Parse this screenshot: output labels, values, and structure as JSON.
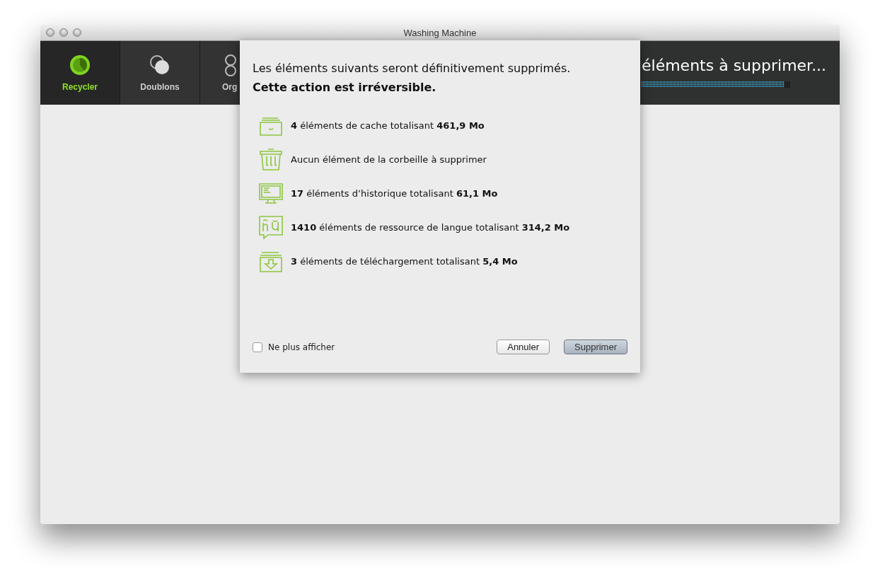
{
  "window": {
    "title": "Washing Machine"
  },
  "tabs": [
    {
      "label": "Recycler",
      "selected": true,
      "kind": "recycle"
    },
    {
      "label": "Doublons",
      "selected": false,
      "kind": "duplicates"
    },
    {
      "label": "Org",
      "selected": false,
      "kind": "organize"
    }
  ],
  "status": {
    "text": "éléments à supprimer...",
    "level": 0.96
  },
  "dialog": {
    "message": "Les éléments suivants seront définitivement supprimés.",
    "warning": "Cette action est irréversible.",
    "items": [
      {
        "kind": "cache",
        "text": "**4** éléments de cache totalisant **461,9 Mo**"
      },
      {
        "kind": "trash",
        "text": "Aucun élément de la corbeille à supprimer"
      },
      {
        "kind": "history",
        "text": "**17** éléments d’historique totalisant **61,1 Mo**"
      },
      {
        "kind": "language",
        "text": "**1410** éléments de ressource de langue totalisant **314,2 Mo**"
      },
      {
        "kind": "download",
        "text": "**3** éléments de téléchargement totalisant **5,4 Mo**"
      }
    ],
    "checkbox": {
      "label": "Ne plus afficher",
      "checked": false
    },
    "buttons": [
      {
        "label": "Annuler",
        "default": false
      },
      {
        "label": "Supprimer",
        "default": true
      }
    ]
  }
}
